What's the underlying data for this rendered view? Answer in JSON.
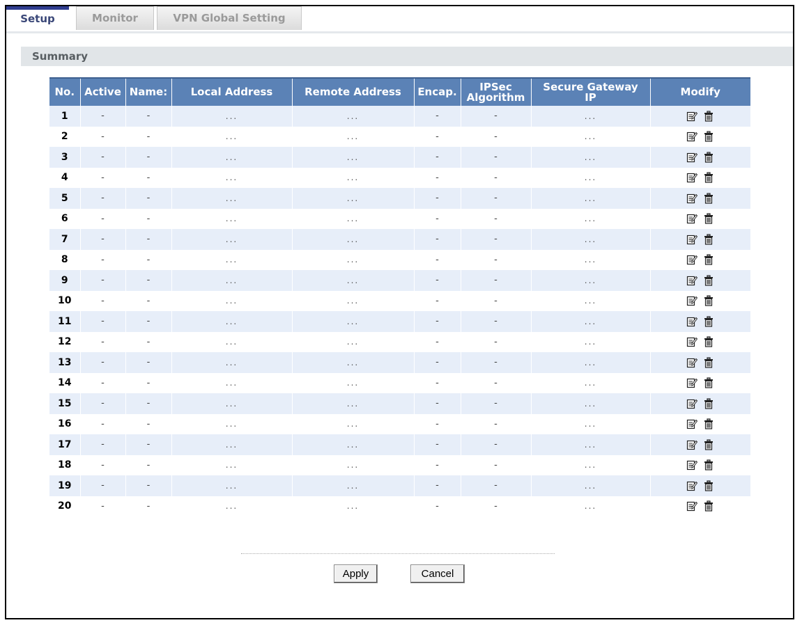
{
  "tabs": {
    "setup": "Setup",
    "monitor": "Monitor",
    "vpn_global": "VPN Global Setting"
  },
  "section_title": "Summary",
  "table": {
    "headers": {
      "no": "No.",
      "active": "Active",
      "name": "Name:",
      "local": "Local Address",
      "remote": "Remote Address",
      "encap": "Encap.",
      "ipsec_line1": "IPSec",
      "ipsec_line2": "Algorithm",
      "gateway_line1": "Secure Gateway",
      "gateway_line2": "IP",
      "modify": "Modify"
    },
    "rows": [
      {
        "no": "1",
        "active": "-",
        "name": "-",
        "local": "...",
        "remote": "...",
        "encap": "-",
        "ipsec": "-",
        "gateway": "..."
      },
      {
        "no": "2",
        "active": "-",
        "name": "-",
        "local": "...",
        "remote": "...",
        "encap": "-",
        "ipsec": "-",
        "gateway": "..."
      },
      {
        "no": "3",
        "active": "-",
        "name": "-",
        "local": "...",
        "remote": "...",
        "encap": "-",
        "ipsec": "-",
        "gateway": "..."
      },
      {
        "no": "4",
        "active": "-",
        "name": "-",
        "local": "...",
        "remote": "...",
        "encap": "-",
        "ipsec": "-",
        "gateway": "..."
      },
      {
        "no": "5",
        "active": "-",
        "name": "-",
        "local": "...",
        "remote": "...",
        "encap": "-",
        "ipsec": "-",
        "gateway": "..."
      },
      {
        "no": "6",
        "active": "-",
        "name": "-",
        "local": "...",
        "remote": "...",
        "encap": "-",
        "ipsec": "-",
        "gateway": "..."
      },
      {
        "no": "7",
        "active": "-",
        "name": "-",
        "local": "...",
        "remote": "...",
        "encap": "-",
        "ipsec": "-",
        "gateway": "..."
      },
      {
        "no": "8",
        "active": "-",
        "name": "-",
        "local": "...",
        "remote": "...",
        "encap": "-",
        "ipsec": "-",
        "gateway": "..."
      },
      {
        "no": "9",
        "active": "-",
        "name": "-",
        "local": "...",
        "remote": "...",
        "encap": "-",
        "ipsec": "-",
        "gateway": "..."
      },
      {
        "no": "10",
        "active": "-",
        "name": "-",
        "local": "...",
        "remote": "...",
        "encap": "-",
        "ipsec": "-",
        "gateway": "..."
      },
      {
        "no": "11",
        "active": "-",
        "name": "-",
        "local": "...",
        "remote": "...",
        "encap": "-",
        "ipsec": "-",
        "gateway": "..."
      },
      {
        "no": "12",
        "active": "-",
        "name": "-",
        "local": "...",
        "remote": "...",
        "encap": "-",
        "ipsec": "-",
        "gateway": "..."
      },
      {
        "no": "13",
        "active": "-",
        "name": "-",
        "local": "...",
        "remote": "...",
        "encap": "-",
        "ipsec": "-",
        "gateway": "..."
      },
      {
        "no": "14",
        "active": "-",
        "name": "-",
        "local": "...",
        "remote": "...",
        "encap": "-",
        "ipsec": "-",
        "gateway": "..."
      },
      {
        "no": "15",
        "active": "-",
        "name": "-",
        "local": "...",
        "remote": "...",
        "encap": "-",
        "ipsec": "-",
        "gateway": "..."
      },
      {
        "no": "16",
        "active": "-",
        "name": "-",
        "local": "...",
        "remote": "...",
        "encap": "-",
        "ipsec": "-",
        "gateway": "..."
      },
      {
        "no": "17",
        "active": "-",
        "name": "-",
        "local": "...",
        "remote": "...",
        "encap": "-",
        "ipsec": "-",
        "gateway": "..."
      },
      {
        "no": "18",
        "active": "-",
        "name": "-",
        "local": "...",
        "remote": "...",
        "encap": "-",
        "ipsec": "-",
        "gateway": "..."
      },
      {
        "no": "19",
        "active": "-",
        "name": "-",
        "local": "...",
        "remote": "...",
        "encap": "-",
        "ipsec": "-",
        "gateway": "..."
      },
      {
        "no": "20",
        "active": "-",
        "name": "-",
        "local": "...",
        "remote": "...",
        "encap": "-",
        "ipsec": "-",
        "gateway": "..."
      }
    ]
  },
  "icons": {
    "edit": "edit-icon",
    "delete": "trash-icon"
  },
  "buttons": {
    "apply": "Apply",
    "cancel": "Cancel"
  },
  "colors": {
    "header_bg": "#5b82b6",
    "row_alt_bg": "#e7eef9",
    "active_tab_accent": "#2f3d8f",
    "section_bar_bg": "#e1e5e8"
  }
}
